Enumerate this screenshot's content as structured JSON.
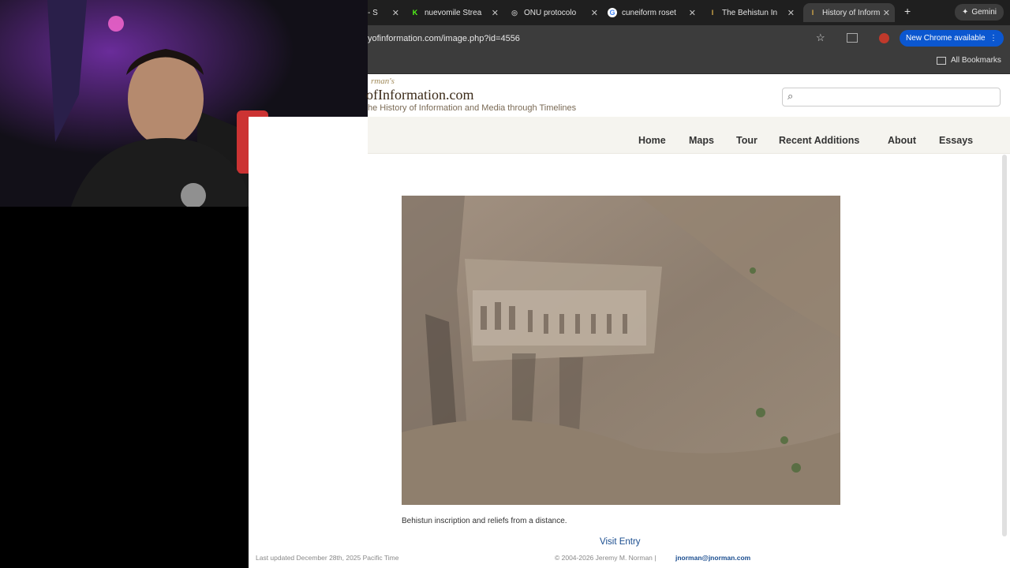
{
  "browser": {
    "tabs": [
      {
        "label": "- S",
        "active": false
      },
      {
        "label": "nuevomile Strea",
        "active": false
      },
      {
        "label": "ONU protocolo",
        "active": false
      },
      {
        "label": "cuneiform roset",
        "active": false
      },
      {
        "label": "The Behistun In",
        "active": false
      },
      {
        "label": "History of Inform",
        "active": true
      }
    ],
    "gemini_label": "Gemini",
    "url": "yofinformation.com/image.php?id=4556",
    "new_chrome_label": "New Chrome available",
    "all_bookmarks_label": "All Bookmarks"
  },
  "site": {
    "logo_pre": "rman's",
    "logo_main": "ofInformation.com",
    "tagline": "he History of Information and Media through Timelines",
    "nav": [
      "Home",
      "Maps",
      "Tour",
      "Recent Additions",
      "About",
      "Essays"
    ],
    "search_placeholder": ""
  },
  "content": {
    "caption": "Behistun inscription and reliefs from a distance.",
    "visit_entry": "Visit Entry"
  },
  "footer": {
    "last_updated": "Last updated December 28th, 2025 Pacific Time",
    "copyright": "© 2004-2026 Jeremy M. Norman |",
    "email": "jnorman@jnorman.com"
  },
  "colors": {
    "accent": "#0b57d0",
    "link": "#1a4d8f",
    "rock": "#8a7a6a"
  }
}
